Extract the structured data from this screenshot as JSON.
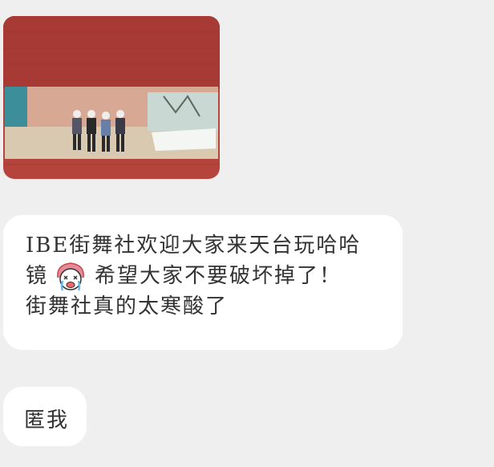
{
  "chat": {
    "messages": [
      {
        "type": "image",
        "content": "photo"
      },
      {
        "type": "text",
        "line1": "IBE街舞社欢迎大家来天台玩哈哈",
        "line2_pre": "镜",
        "sticker": "crying-girl-sticker",
        "line2_post": "希望大家不要破坏掉了！",
        "line3": "街舞社真的太寒酸了"
      },
      {
        "type": "text",
        "line1": "匿我"
      }
    ]
  },
  "colors": {
    "background": "#efefef",
    "bubble": "#ffffff",
    "wall": "#b5443d",
    "text": "#333333"
  }
}
